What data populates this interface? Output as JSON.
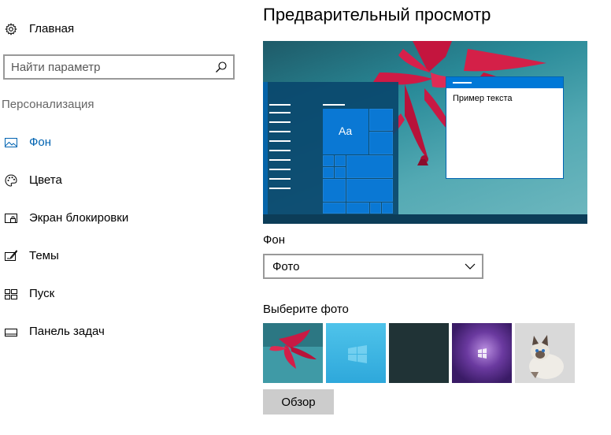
{
  "sidebar": {
    "home_label": "Главная",
    "search_placeholder": "Найти параметр",
    "section_title": "Персонализация",
    "items": [
      {
        "label": "Фон",
        "icon": "picture-icon",
        "active": true
      },
      {
        "label": "Цвета",
        "icon": "palette-icon",
        "active": false
      },
      {
        "label": "Экран блокировки",
        "icon": "lock-screen-icon",
        "active": false
      },
      {
        "label": "Темы",
        "icon": "themes-icon",
        "active": false
      },
      {
        "label": "Пуск",
        "icon": "start-icon",
        "active": false
      },
      {
        "label": "Панель задач",
        "icon": "taskbar-icon",
        "active": false
      }
    ]
  },
  "main": {
    "title": "Предварительный просмотр",
    "preview": {
      "tile_text": "Aa",
      "sample_text": "Пример текста"
    },
    "background_label": "Фон",
    "background_value": "Фото",
    "choose_label": "Выберите фото",
    "browse_label": "Обзор"
  },
  "colors": {
    "accent": "#0078d7",
    "active_text": "#0063b1",
    "button_bg": "#cccccc"
  }
}
